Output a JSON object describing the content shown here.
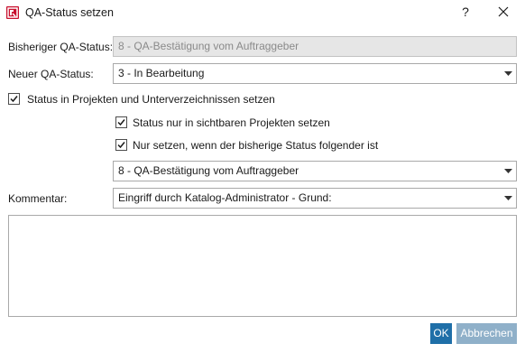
{
  "window": {
    "title": "QA-Status setzen",
    "help_label": "?"
  },
  "form": {
    "previous_status_label": "Bisheriger QA-Status:",
    "previous_status_value": "8 - QA-Bestätigung vom Auftraggeber",
    "new_status_label": "Neuer QA-Status:",
    "new_status_value": "3 - In Bearbeitung",
    "set_in_projects_label": "Status in Projekten und Unterverzeichnissen setzen",
    "visible_projects_only_label": "Status nur in sichtbaren Projekten setzen",
    "only_if_previous_label": "Nur setzen, wenn der bisherige Status folgender ist",
    "condition_status_value": "8 - QA-Bestätigung vom Auftraggeber",
    "comment_label": "Kommentar:",
    "comment_preset_value": "Eingriff durch Katalog-Administrator - Grund:",
    "comment_text": ""
  },
  "checkboxes": {
    "set_in_projects": true,
    "visible_projects_only": true,
    "only_if_previous": true
  },
  "buttons": {
    "ok_label": "OK",
    "cancel_label": "Abbrechen"
  },
  "colors": {
    "accent": "#1f6fa8",
    "app_icon": "#c8102e",
    "disabled_button": "#8fb0c9"
  }
}
